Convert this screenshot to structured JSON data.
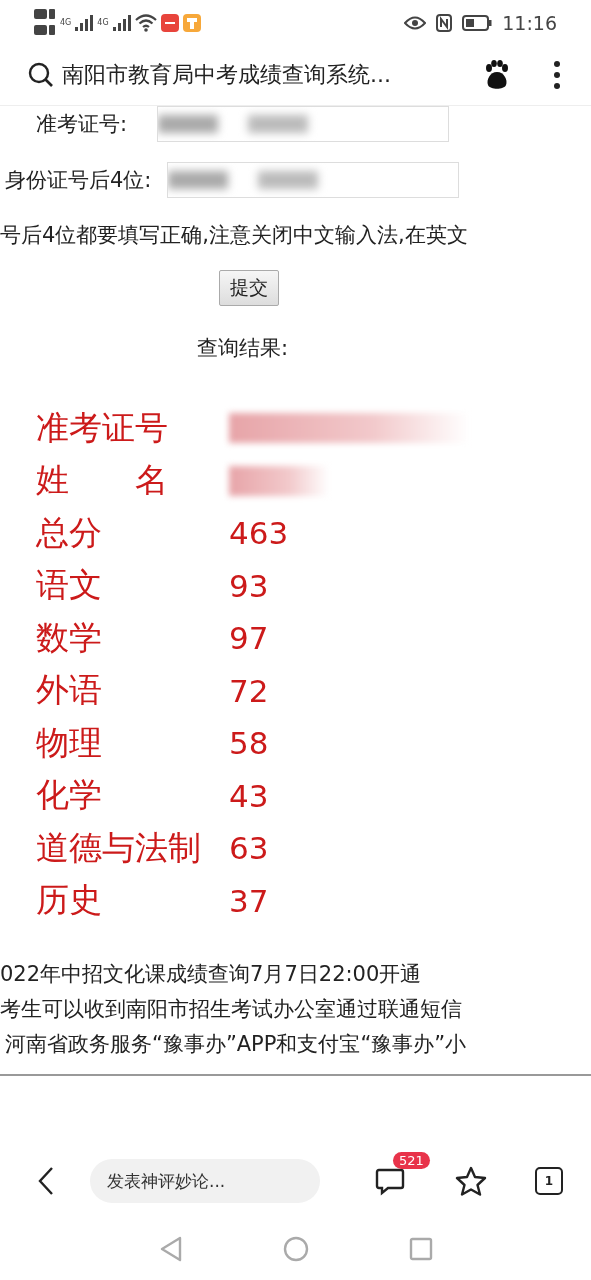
{
  "status_bar": {
    "network_labels": [
      "4G",
      "4G"
    ],
    "time": "11:16"
  },
  "address_bar": {
    "title": "南阳市教育局中考成绩查询系统..."
  },
  "form": {
    "fields": [
      {
        "label": "准考证号:",
        "kind": "redacted"
      },
      {
        "label": "身份证号后4位:",
        "kind": "redacted"
      }
    ],
    "notice": "号后4位都要填写正确,注意关闭中文输入法,在英文",
    "submit": "提交"
  },
  "results": {
    "heading": "查询结果:",
    "rows": [
      {
        "label": "准考证号",
        "kind": "redacted"
      },
      {
        "label": "姓　　名",
        "kind": "redacted"
      },
      {
        "label": "总分",
        "kind": "text",
        "value": "463"
      },
      {
        "label": "语文",
        "kind": "text",
        "value": "93"
      },
      {
        "label": "数学",
        "kind": "text",
        "value": "97"
      },
      {
        "label": "外语",
        "kind": "text",
        "value": "72"
      },
      {
        "label": "物理",
        "kind": "text",
        "value": "58"
      },
      {
        "label": "化学",
        "kind": "text",
        "value": "43"
      },
      {
        "label": "道德与法制",
        "kind": "text",
        "value": "63"
      },
      {
        "label": "历史",
        "kind": "text",
        "value": "37"
      }
    ]
  },
  "footer_lines": [
    "022年中招文化课成绩查询7月7日22:00开通",
    "考生可以收到南阳市招生考试办公室通过联通短信",
    "河南省政务服务“豫事办”APP和支付宝“豫事办”小"
  ],
  "toolbar": {
    "comment_placeholder": "发表神评妙论...",
    "comment_count": "521",
    "tab_count": "1"
  }
}
